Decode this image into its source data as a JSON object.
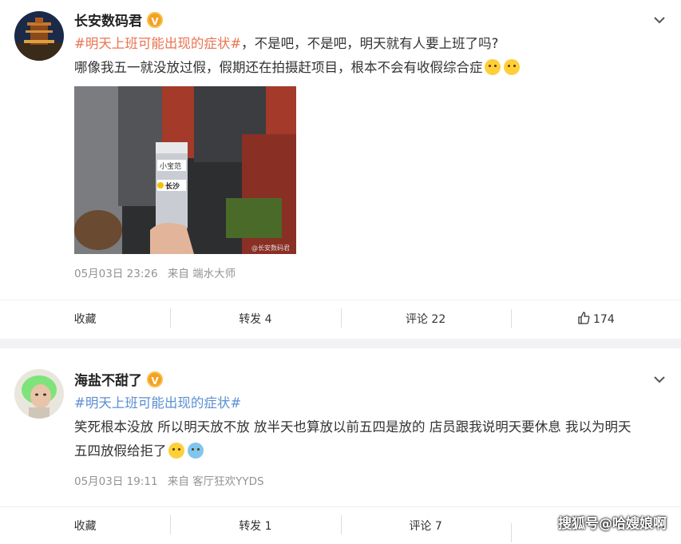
{
  "posts": [
    {
      "author": "长安数码君",
      "badge": "V",
      "hashtag": "#明天上班可能出现的症状#",
      "line1_rest": "，不是吧，不是吧，明天就有人要上班了吗?",
      "line2": "哪像我五一就没放过假，假期还在拍摄赶项目，根本不会有收假综合症",
      "photo_cup_text1": "小宝范",
      "photo_cup_text2": "长沙",
      "photo_watermark": "@长安数码君",
      "time": "05月03日 23:26",
      "source": "来自 端水大师",
      "actions": {
        "fav": "收藏",
        "repost": "转发 4",
        "comment": "评论 22",
        "like": "174"
      }
    },
    {
      "author": "海盐不甜了",
      "badge": "V",
      "hashtag": "#明天上班可能出现的症状#",
      "line1": "笑死根本没放 所以明天放不放 放半天也算放以前五四是放的 店员跟我说明天要休息 我以为明天",
      "line2": "五四放假给拒了",
      "time": "05月03日 19:11",
      "source": "来自 客厅狂欢YYDS",
      "actions": {
        "fav": "收藏",
        "repost": "转发 1",
        "comment": "评论 7"
      }
    }
  ],
  "watermark": "搜狐号@哈嫂娘啊"
}
